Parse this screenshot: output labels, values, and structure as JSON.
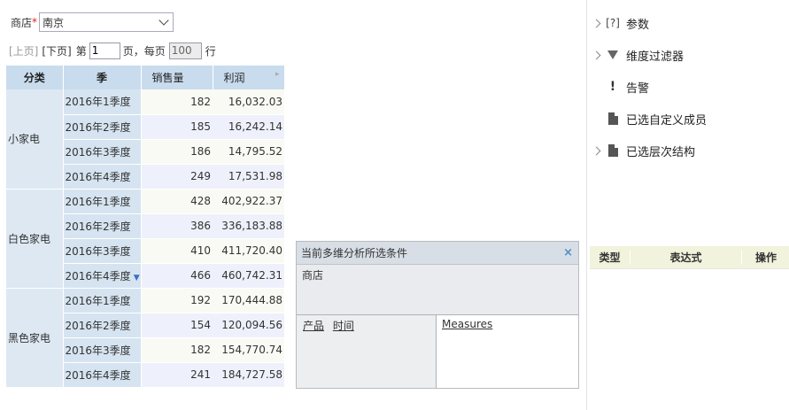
{
  "filter": {
    "label": "商店",
    "required_mark": "*",
    "value": "南京"
  },
  "pager": {
    "prev": "[上页]",
    "next": "[下页]",
    "page_prefix": "第",
    "page_value": "1",
    "page_suffix": "页，每页",
    "size_value": "100",
    "size_suffix": "行"
  },
  "table": {
    "headers": [
      "分类",
      "季",
      "销售量",
      "利润"
    ],
    "groups": [
      {
        "category": "小家电",
        "rows": [
          {
            "quarter": "2016年1季度",
            "sales": "182",
            "profit": "16,032.03"
          },
          {
            "quarter": "2016年2季度",
            "sales": "185",
            "profit": "16,242.14"
          },
          {
            "quarter": "2016年3季度",
            "sales": "186",
            "profit": "14,795.52"
          },
          {
            "quarter": "2016年4季度",
            "sales": "249",
            "profit": "17,531.98"
          }
        ]
      },
      {
        "category": "白色家电",
        "rows": [
          {
            "quarter": "2016年1季度",
            "sales": "428",
            "profit": "402,922.37"
          },
          {
            "quarter": "2016年2季度",
            "sales": "386",
            "profit": "336,183.88"
          },
          {
            "quarter": "2016年3季度",
            "sales": "410",
            "profit": "411,720.40"
          },
          {
            "quarter": "2016年4季度",
            "sales": "466",
            "profit": "460,742.31"
          }
        ]
      },
      {
        "category": "黑色家电",
        "rows": [
          {
            "quarter": "2016年1季度",
            "sales": "192",
            "profit": "170,444.88"
          },
          {
            "quarter": "2016年2季度",
            "sales": "154",
            "profit": "120,094.56"
          },
          {
            "quarter": "2016年3季度",
            "sales": "182",
            "profit": "154,770.74"
          },
          {
            "quarter": "2016年4季度",
            "sales": "241",
            "profit": "184,727.58"
          }
        ]
      }
    ]
  },
  "popup": {
    "title": "当前多维分析所选条件",
    "close": "×",
    "slicer": "商店",
    "rows_items": [
      "产品",
      "时间"
    ],
    "columns_items": [
      "Measures"
    ]
  },
  "right_panel": {
    "items": [
      {
        "label": "参数",
        "icon": "param-icon",
        "expandable": true
      },
      {
        "label": "维度过滤器",
        "icon": "filter-icon",
        "expandable": true
      },
      {
        "label": "告警",
        "icon": "alert-icon",
        "expandable": false
      },
      {
        "label": "已选自定义成员",
        "icon": "doc-icon",
        "expandable": false
      },
      {
        "label": "已选层次结构",
        "icon": "doc-icon",
        "expandable": true
      }
    ],
    "expr_table_headers": [
      "类型",
      "表达式",
      "操作"
    ]
  }
}
